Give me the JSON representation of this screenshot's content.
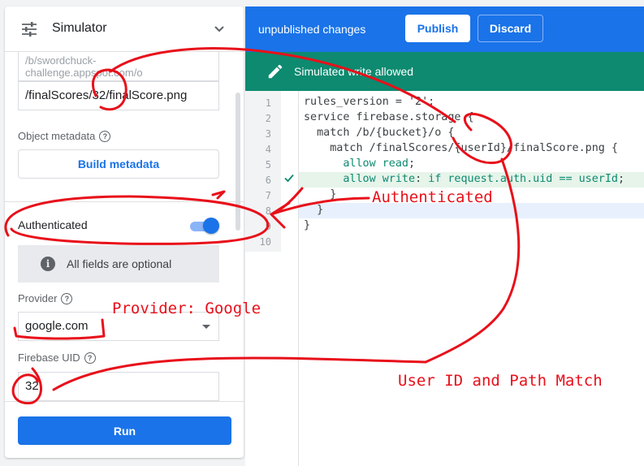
{
  "simulator": {
    "title": "Simulator",
    "location_path_url": "/b/swordchuck-challenge.appspot.com/o",
    "location_path_file": "/finalScores/32/finalScore.png",
    "object_metadata_label": "Object metadata",
    "build_metadata_button": "Build metadata",
    "authenticated_label": "Authenticated",
    "authenticated_on": true,
    "info_text": "All fields are optional",
    "provider_label": "Provider",
    "provider_value": "google.com",
    "firebase_uid_label": "Firebase UID",
    "firebase_uid_value": "32",
    "run_button": "Run"
  },
  "topbar": {
    "status": "unpublished changes",
    "publish_button": "Publish",
    "discard_button": "Discard"
  },
  "banner": {
    "text": "Simulated write allowed"
  },
  "editor": {
    "line_numbers": [
      "1",
      "2",
      "3",
      "4",
      "5",
      "6",
      "7",
      "8",
      "9",
      "10"
    ],
    "lines": [
      "rules_version = '2';",
      "service firebase.storage {",
      "  match /b/{bucket}/o {",
      "    match /finalScores/{userId}/finalScore.png {",
      "      allow read;",
      "      allow write: if request.auth.uid == userId;",
      "    }",
      "  }",
      "}",
      ""
    ]
  },
  "annotations": {
    "authenticated": "Authenticated",
    "provider": "Provider: Google",
    "user_id_match": "User ID and Path Match"
  },
  "colors": {
    "primary": "#1a73e8",
    "banner_green": "#0d8a70",
    "annotation_red": "#e8101a"
  }
}
